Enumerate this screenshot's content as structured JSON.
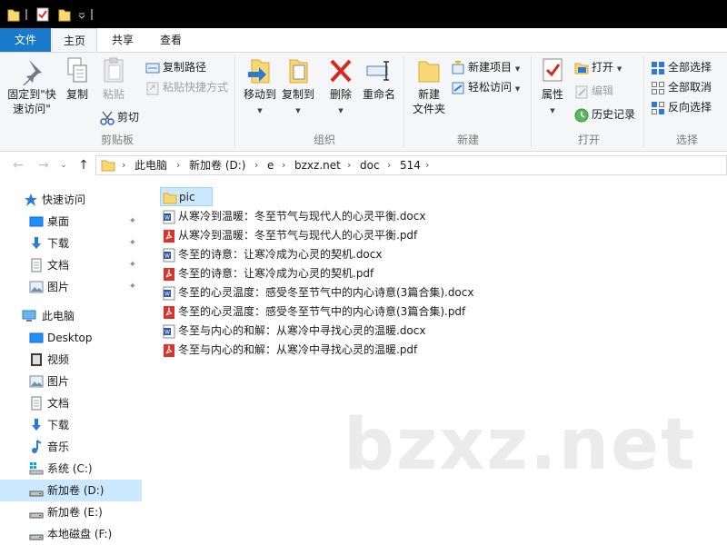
{
  "ribbon_tabs": {
    "file": "文件",
    "home": "主页",
    "share": "共享",
    "view": "查看"
  },
  "clipboard": {
    "pin_quick_access": "固定到\"快速访问\"",
    "copy": "复制",
    "paste": "粘贴",
    "copy_path": "复制路径",
    "paste_shortcut": "粘贴快捷方式",
    "cut": "剪切",
    "label": "剪贴板"
  },
  "organize": {
    "move_to": "移动到",
    "copy_to": "复制到",
    "delete": "删除",
    "rename": "重命名",
    "label": "组织"
  },
  "new": {
    "new_folder": "新建\n文件夹",
    "new_item": "新建项目",
    "easy_access": "轻松访问",
    "label": "新建"
  },
  "open": {
    "properties": "属性",
    "open": "打开",
    "edit": "编辑",
    "history": "历史记录",
    "label": "打开"
  },
  "select": {
    "select_all": "全部选择",
    "select_none": "全部取消",
    "invert": "反向选择",
    "label": "选择"
  },
  "address": {
    "crumbs": [
      "此电脑",
      "新加卷 (D:)",
      "e",
      "bzxz.net",
      "doc",
      "514"
    ]
  },
  "nav": {
    "quick_access": "快速访问",
    "quick_items": [
      "桌面",
      "下载",
      "文档",
      "图片"
    ],
    "this_pc": "此电脑",
    "pc_items": [
      "Desktop",
      "视频",
      "图片",
      "文档",
      "下载",
      "音乐",
      "系统 (C:)",
      "新加卷 (D:)",
      "新加卷 (E:)",
      "本地磁盘 (F:)"
    ]
  },
  "files": [
    {
      "name": "pic",
      "type": "folder"
    },
    {
      "name": "从寒冷到温暖：冬至节气与现代人的心灵平衡.docx",
      "type": "docx"
    },
    {
      "name": "从寒冷到温暖：冬至节气与现代人的心灵平衡.pdf",
      "type": "pdf"
    },
    {
      "name": "冬至的诗意：让寒冷成为心灵的契机.docx",
      "type": "docx"
    },
    {
      "name": "冬至的诗意：让寒冷成为心灵的契机.pdf",
      "type": "pdf"
    },
    {
      "name": "冬至的心灵温度：感受冬至节气中的内心诗意(3篇合集).docx",
      "type": "docx"
    },
    {
      "name": "冬至的心灵温度：感受冬至节气中的内心诗意(3篇合集).pdf",
      "type": "pdf"
    },
    {
      "name": "冬至与内心的和解：从寒冷中寻找心灵的温暖.docx",
      "type": "docx"
    },
    {
      "name": "冬至与内心的和解：从寒冷中寻找心灵的温暖.pdf",
      "type": "pdf"
    }
  ],
  "watermark": "bzxz.net",
  "colors": {
    "accent": "#1979ca",
    "selection": "#cce8ff",
    "folder": "#f8d775",
    "pdf": "#d9342b",
    "word": "#2b579a"
  }
}
